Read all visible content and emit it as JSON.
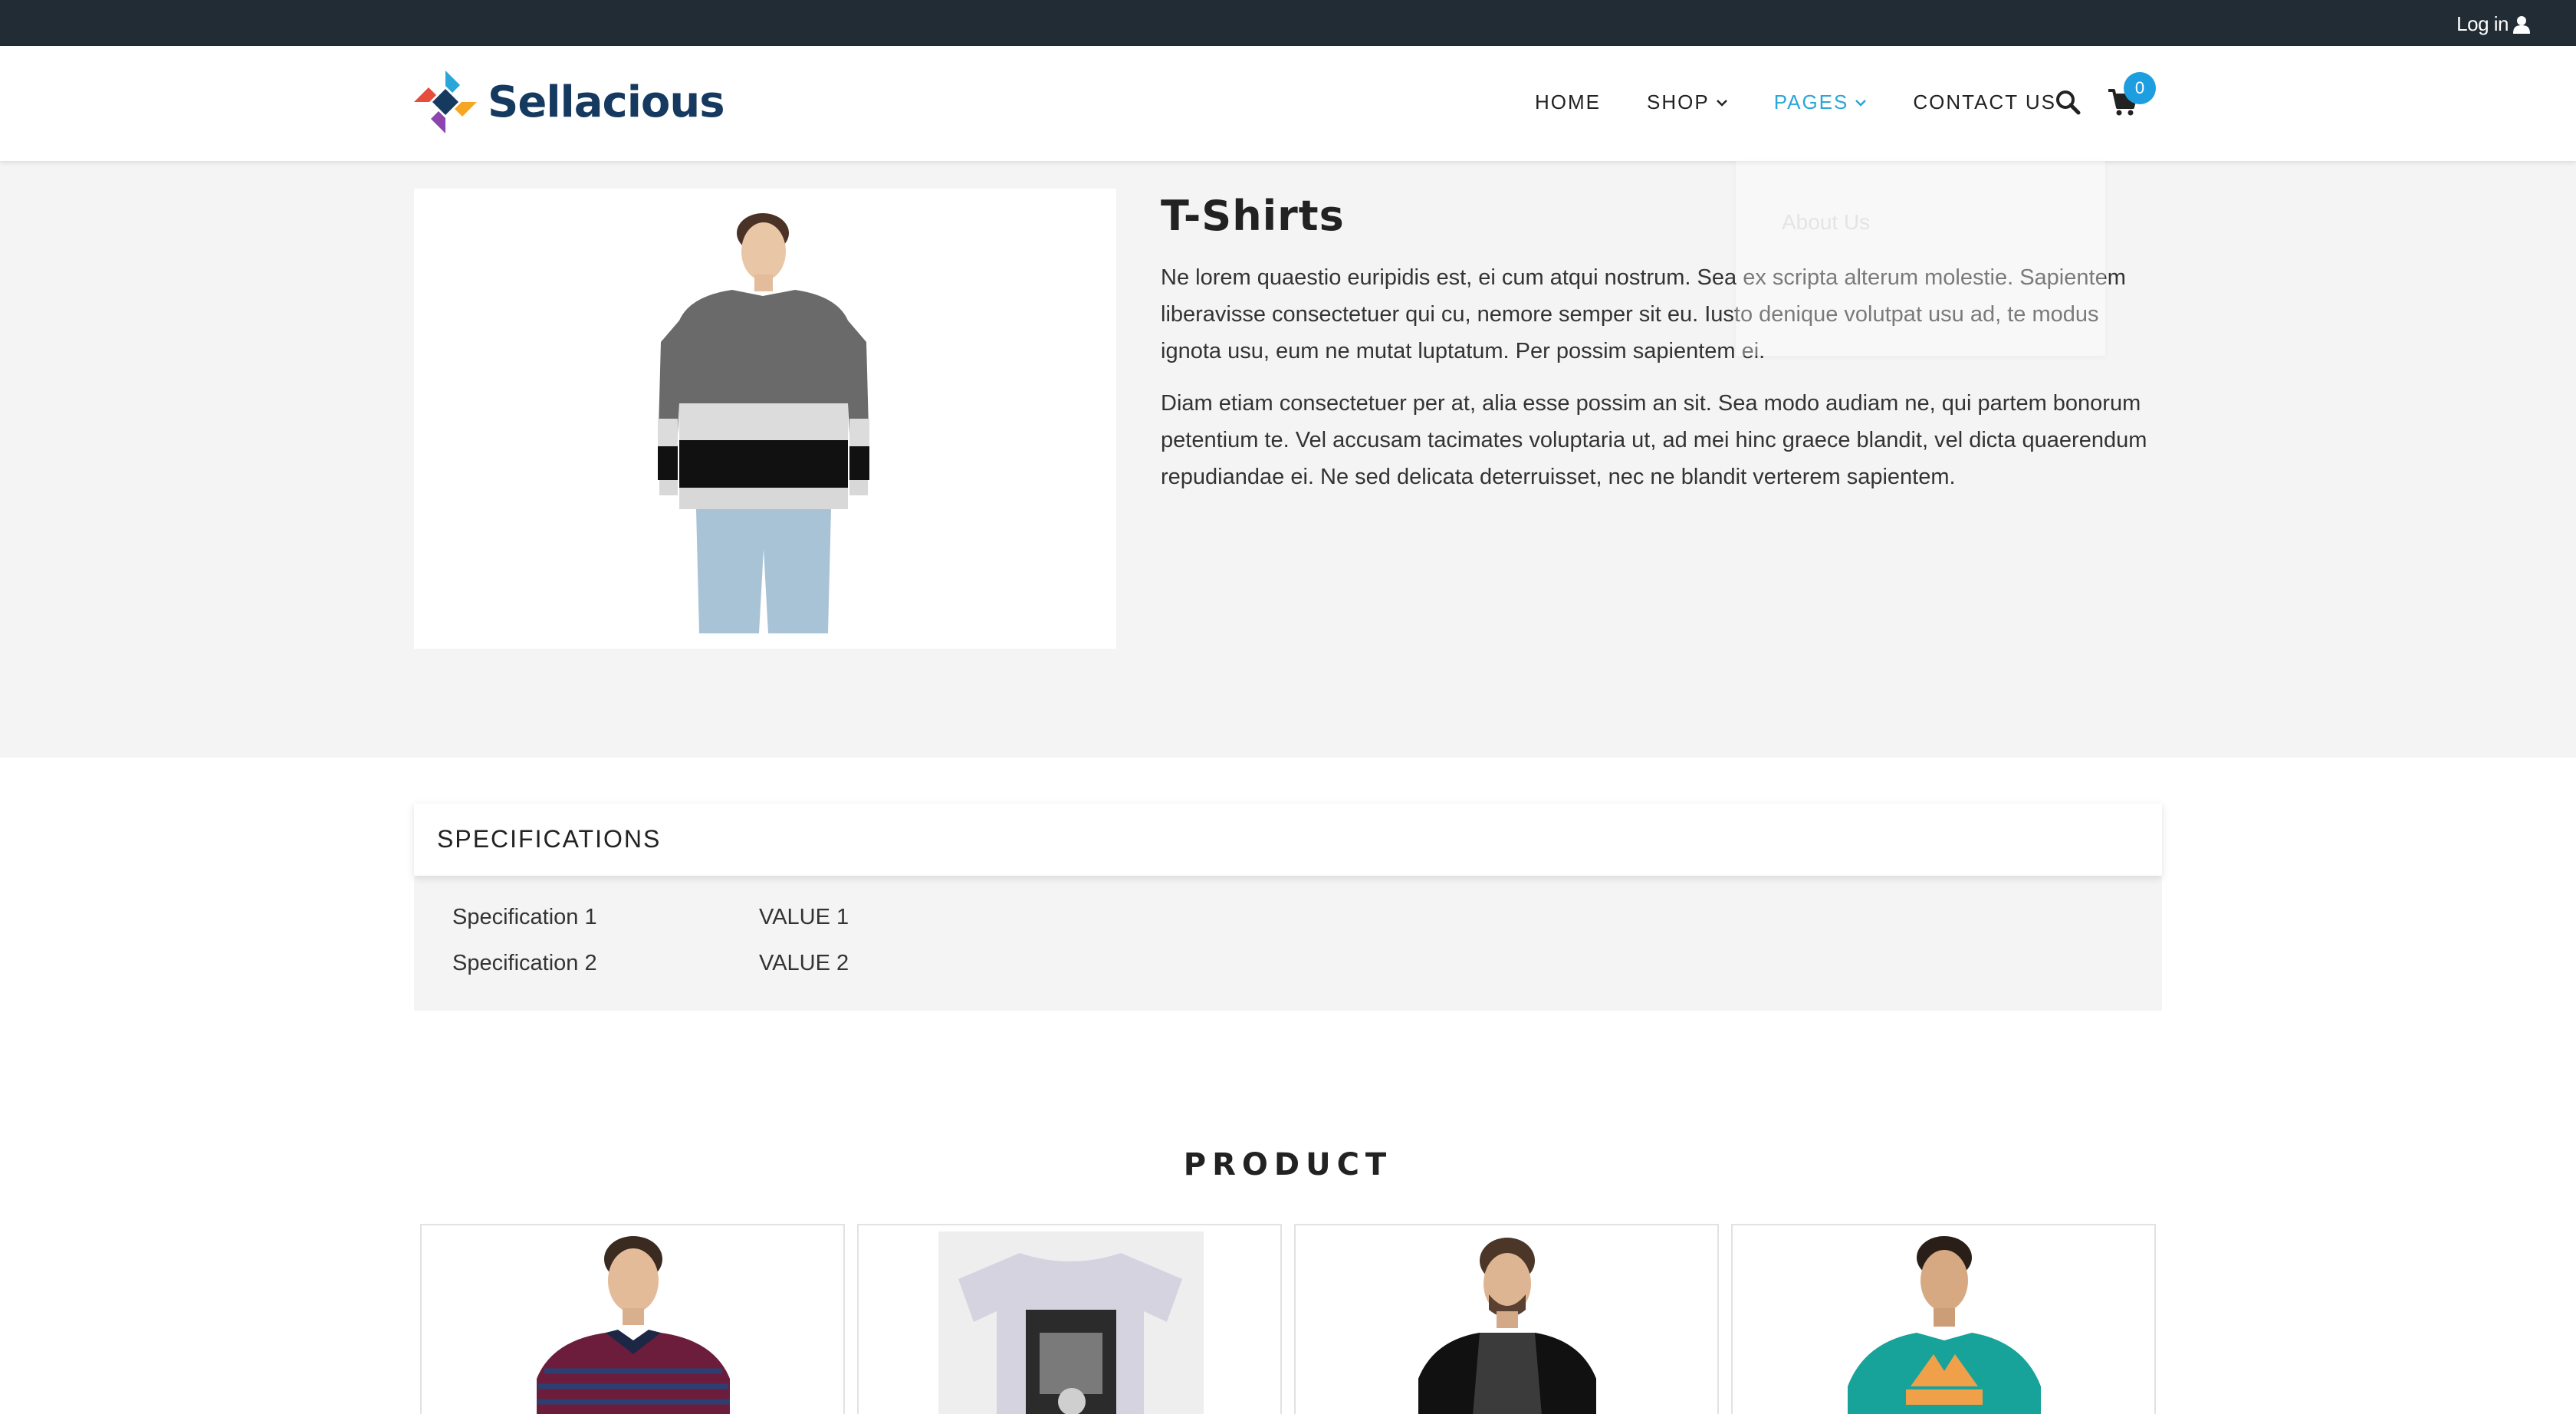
{
  "topbar": {
    "login_label": "Log in"
  },
  "brand": {
    "name": "Sellacious"
  },
  "nav": {
    "items": [
      {
        "label": "HOME",
        "has_dropdown": false,
        "active": false
      },
      {
        "label": "SHOP",
        "has_dropdown": true,
        "active": false
      },
      {
        "label": "PAGES",
        "has_dropdown": true,
        "active": true
      },
      {
        "label": "CONTACT US",
        "has_dropdown": false,
        "active": false
      }
    ],
    "cart_count": "0",
    "icons": [
      "search-icon",
      "cart-icon",
      "user-icon",
      "chevron-down-icon"
    ]
  },
  "pages_dropdown": {
    "items": [
      "About Us"
    ]
  },
  "product": {
    "title": "T-Shirts",
    "description": [
      "Ne lorem quaestio euripidis est, ei cum atqui nostrum. Sea ex scripta alterum molestie. Sapientem liberavisse consectetuer qui cu, nemore semper sit eu. Iusto denique volutpat usu ad, te modus ignota usu, eum ne mutat luptatum. Per possim sapientem ei.",
      "Diam etiam consectetuer per at, alia esse possim an sit. Sea modo audiam ne, qui partem bonorum petentium te. Vel accusam tacimates voluptaria ut, ad mei hinc graece blandit, vel dicta quaerendum repudiandae ei. Ne sed delicata deterruisset, nec ne blandit verterem sapientem."
    ]
  },
  "specifications": {
    "heading": "SPECIFICATIONS",
    "rows": [
      {
        "name": "Specification 1",
        "value": "VALUE 1"
      },
      {
        "name": "Specification 2",
        "value": "VALUE 2"
      }
    ]
  },
  "related": {
    "heading": "PRODUCT"
  },
  "colors": {
    "topbar": "#222c34",
    "accent": "#2aa6d8",
    "brand": "#16395f",
    "badge": "#1d9ee0",
    "hero_bg": "#f4f4f4"
  }
}
